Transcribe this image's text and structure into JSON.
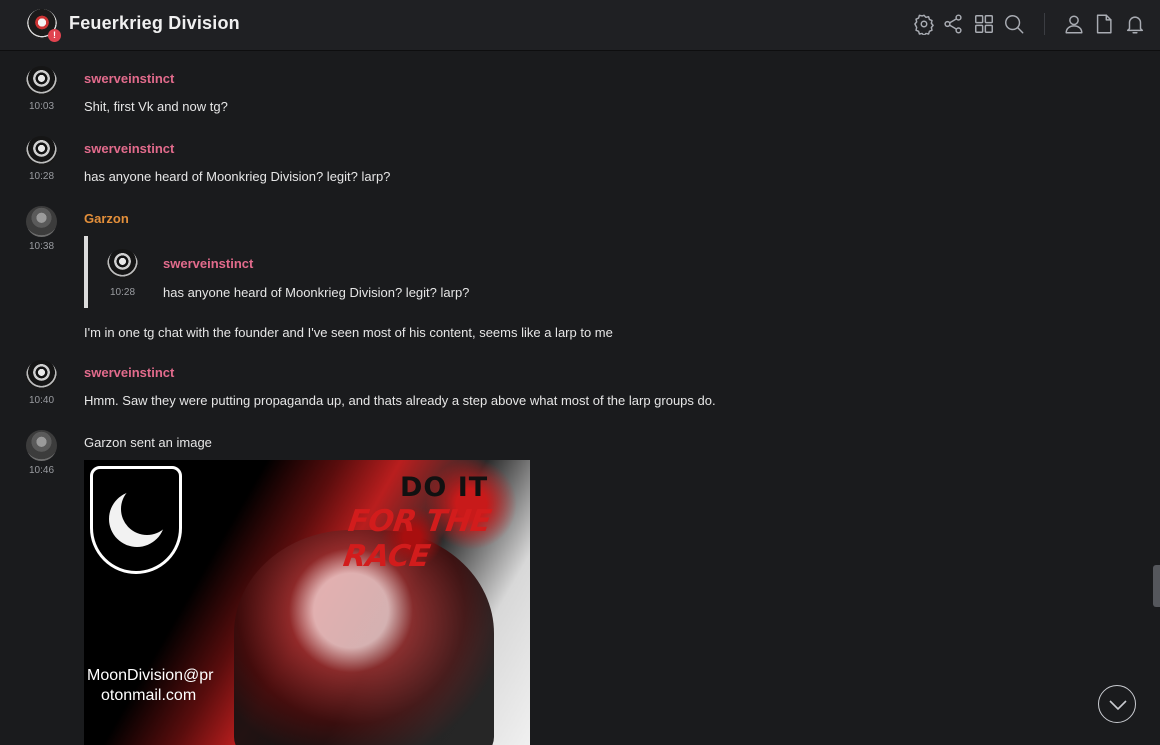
{
  "room": {
    "title": "Feuerkrieg Division",
    "notification_badge": "!"
  },
  "toolbar": {
    "icons": [
      "settings-icon",
      "share-icon",
      "apps-icon",
      "search-icon",
      "members-icon",
      "files-icon",
      "notifications-icon"
    ]
  },
  "messages": [
    {
      "time": "10:03",
      "sender": "swerveinstinct",
      "text": "Shit, first Vk and now tg?"
    },
    {
      "time": "10:28",
      "sender": "swerveinstinct",
      "text": "has anyone heard of Moonkrieg Division?  legit?  larp?"
    },
    {
      "time": "10:38",
      "sender": "Garzon",
      "text": "I'm in one tg chat with the founder and I've seen most of his content, seems like a larp to me",
      "quote": {
        "time": "10:28",
        "sender": "swerveinstinct",
        "text": "has anyone heard of Moonkrieg Division?  legit?  larp?"
      }
    },
    {
      "time": "10:40",
      "sender": "swerveinstinct",
      "text": "Hmm. Saw they were putting propaganda up, and thats already a step above what most of the larp groups do."
    },
    {
      "time": "10:46",
      "sender": "Garzon",
      "text": "Garzon sent an image",
      "image": {
        "headline": "DO IT",
        "subline": "FOR THE RACE",
        "email_line1": "MoonDivision@pr",
        "email_line2": "otonmail.com"
      }
    }
  ],
  "colors": {
    "sender_swerveinstinct": "#e26b8c",
    "sender_garzon": "#e38f3a",
    "background": "#1a1b1d"
  }
}
